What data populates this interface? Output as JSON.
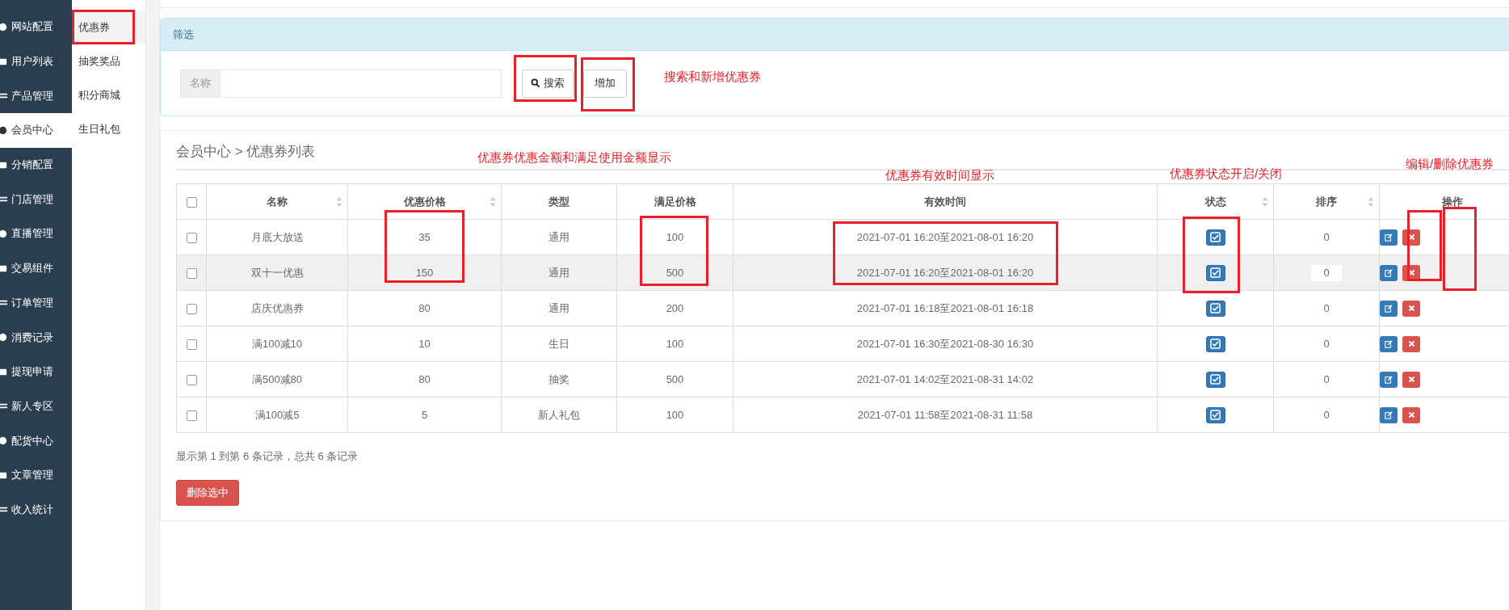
{
  "sidebar": {
    "items": [
      {
        "label": "网站配置",
        "selected": false
      },
      {
        "label": "用户列表",
        "selected": false
      },
      {
        "label": "产品管理",
        "selected": false
      },
      {
        "label": "会员中心",
        "selected": true
      },
      {
        "label": "分销配置",
        "selected": false
      },
      {
        "label": "门店管理",
        "selected": false
      },
      {
        "label": "直播管理",
        "selected": false
      },
      {
        "label": "交易组件",
        "selected": false
      },
      {
        "label": "订单管理",
        "selected": false
      },
      {
        "label": "消费记录",
        "selected": false
      },
      {
        "label": "提现申请",
        "selected": false
      },
      {
        "label": "新人专区",
        "selected": false
      },
      {
        "label": "配货中心",
        "selected": false
      },
      {
        "label": "文章管理",
        "selected": false
      },
      {
        "label": "收入统计",
        "selected": false
      }
    ]
  },
  "submenu": {
    "items": [
      {
        "label": "优惠券",
        "selected": true
      },
      {
        "label": "抽奖奖品",
        "selected": false
      },
      {
        "label": "积分商城",
        "selected": false
      },
      {
        "label": "生日礼包",
        "selected": false
      }
    ]
  },
  "filter": {
    "title": "筛选",
    "field_label": "名称",
    "search_button": "搜索",
    "add_button": "增加"
  },
  "list": {
    "breadcrumb": "会员中心 > 优惠券列表",
    "select_all_checked": false,
    "columns": [
      {
        "label": "名称",
        "sortable": true
      },
      {
        "label": "优惠价格",
        "sortable": true
      },
      {
        "label": "类型",
        "sortable": false
      },
      {
        "label": "满足价格",
        "sortable": false
      },
      {
        "label": "有效时间",
        "sortable": false
      },
      {
        "label": "状态",
        "sortable": true
      },
      {
        "label": "排序",
        "sortable": true
      },
      {
        "label": "操作",
        "sortable": false
      }
    ],
    "rows": [
      {
        "checked": false,
        "highlighted": false,
        "enabled": true,
        "name": "月底大放送",
        "discount": "35",
        "type": "通用",
        "threshold": "100",
        "valid": "2021-07-01 16:20至2021-08-01 16:20",
        "sort": "0"
      },
      {
        "checked": false,
        "highlighted": true,
        "enabled": true,
        "name": "双十一优惠",
        "discount": "150",
        "type": "通用",
        "threshold": "500",
        "valid": "2021-07-01 16:20至2021-08-01 16:20",
        "sort": "0"
      },
      {
        "checked": false,
        "highlighted": false,
        "enabled": true,
        "name": "店庆优惠券",
        "discount": "80",
        "type": "通用",
        "threshold": "200",
        "valid": "2021-07-01 16:18至2021-08-01 16:18",
        "sort": "0"
      },
      {
        "checked": false,
        "highlighted": false,
        "enabled": true,
        "name": "满100减10",
        "discount": "10",
        "type": "生日",
        "threshold": "100",
        "valid": "2021-07-01 16:30至2021-08-30 16:30",
        "sort": "0"
      },
      {
        "checked": false,
        "highlighted": false,
        "enabled": true,
        "name": "满500减80",
        "discount": "80",
        "type": "抽奖",
        "threshold": "500",
        "valid": "2021-07-01 14:02至2021-08-31 14:02",
        "sort": "0"
      },
      {
        "checked": false,
        "highlighted": false,
        "enabled": true,
        "name": "满100减5",
        "discount": "5",
        "type": "新人礼包",
        "threshold": "100",
        "valid": "2021-07-01 11:58至2021-08-31 11:58",
        "sort": "0"
      }
    ],
    "summary": "显示第 1 到第 6 条记录，总共 6 条记录",
    "delete_selected": "删除选中"
  },
  "annotations": [
    {
      "text": "搜索和新增优惠券"
    },
    {
      "text": "优惠券优惠金额和满足使用金额显示"
    },
    {
      "text": "优惠券有效时间显示"
    },
    {
      "text": "优惠券状态开启/关闭"
    },
    {
      "text": "编辑/删除优惠券"
    }
  ]
}
